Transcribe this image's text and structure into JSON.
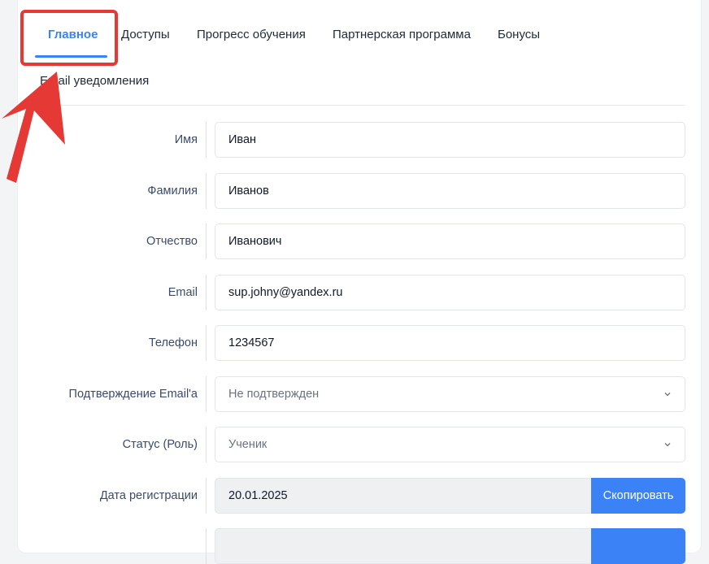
{
  "tabs": [
    {
      "label": "Главное"
    },
    {
      "label": "Доступы"
    },
    {
      "label": "Прогресс обучения"
    },
    {
      "label": "Партнерская программа"
    },
    {
      "label": "Бонусы"
    },
    {
      "label": "Email уведомления"
    }
  ],
  "form": {
    "first_name": {
      "label": "Имя",
      "value": "Иван"
    },
    "last_name": {
      "label": "Фамилия",
      "value": "Иванов"
    },
    "middle_name": {
      "label": "Отчество",
      "value": "Иванович"
    },
    "email": {
      "label": "Email",
      "value": "sup.johny@yandex.ru"
    },
    "phone": {
      "label": "Телефон",
      "value": "1234567"
    },
    "email_confirm": {
      "label": "Подтверждение Email'a",
      "value": "Не подтвержден"
    },
    "role": {
      "label": "Статус (Роль)",
      "value": "Ученик"
    },
    "reg_date": {
      "label": "Дата регистрации",
      "value": "20.01.2025",
      "button": "Скопировать"
    }
  },
  "colors": {
    "accent": "#3b82f6",
    "highlight": "#e53935"
  }
}
